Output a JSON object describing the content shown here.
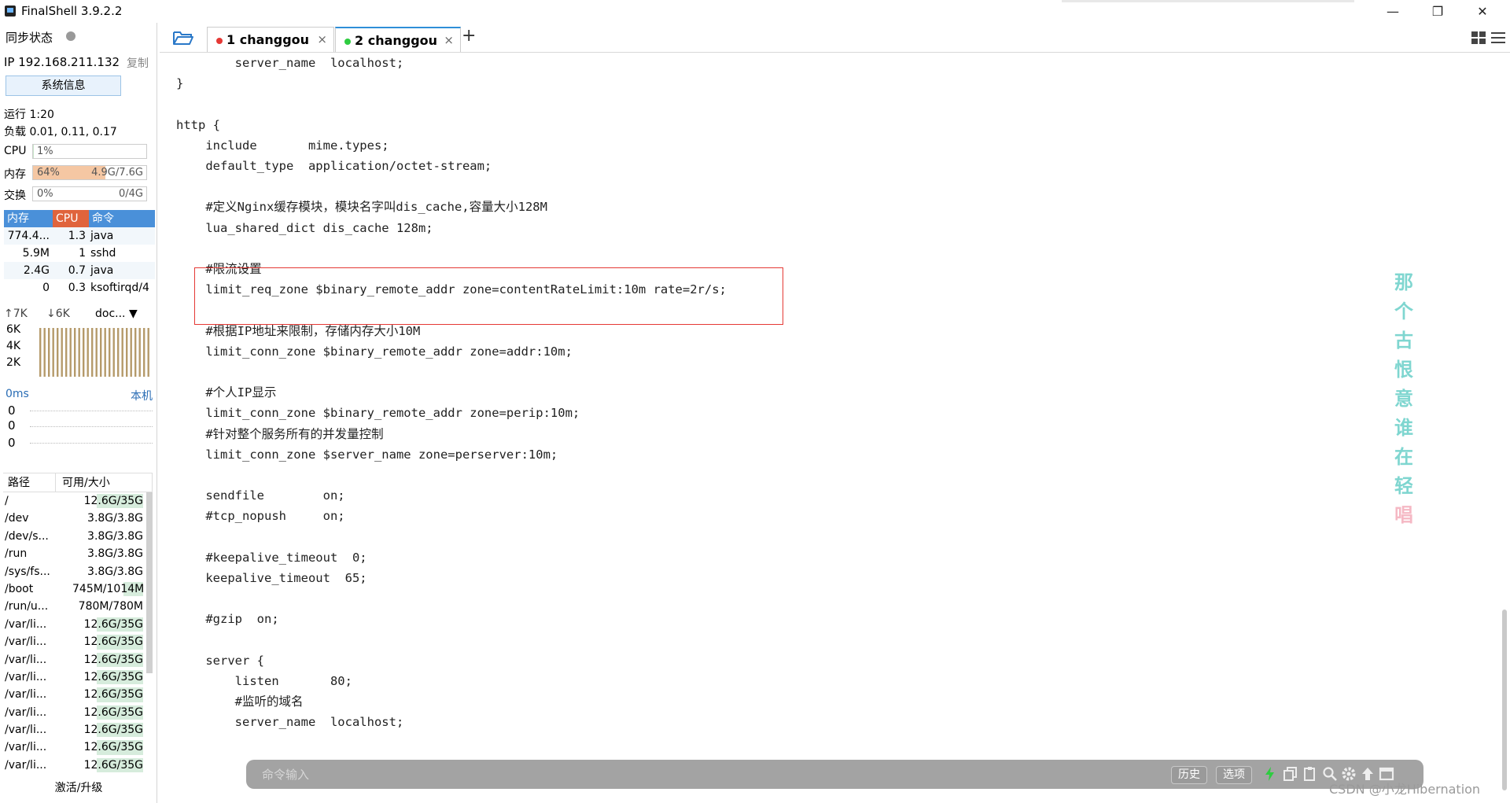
{
  "window": {
    "title": "FinalShell 3.9.2.2",
    "minimize": "—",
    "maximize": "❐",
    "close": "✕"
  },
  "left": {
    "sync_label": "同步状态",
    "ip": "IP 192.168.211.132",
    "copy": "复制",
    "sysinfo": "系统信息",
    "uptime": "运行 1:20",
    "load": "负载 0.01, 0.11, 0.17",
    "cpu": {
      "label": "CPU",
      "pct": "1%",
      "fraction": 0.01
    },
    "mem": {
      "label": "内存",
      "pct": "64%",
      "value": "4.9G/7.6G",
      "fraction": 0.64
    },
    "swap": {
      "label": "交换",
      "pct": "0%",
      "value": "0/4G",
      "fraction": 0.0
    },
    "proc_headers": [
      "内存",
      "CPU",
      "命令"
    ],
    "processes": [
      {
        "mem": "774.4...",
        "cpu": "1.3",
        "cmd": "java"
      },
      {
        "mem": "5.9M",
        "cpu": "1",
        "cmd": "sshd"
      },
      {
        "mem": "2.4G",
        "cpu": "0.7",
        "cmd": "java"
      },
      {
        "mem": "0",
        "cpu": "0.3",
        "cmd": "ksoftirqd/4"
      }
    ],
    "net": {
      "up": "↑7K",
      "down": "↓6K",
      "iface": "doc...",
      "ylabels": [
        "6K",
        "4K",
        "2K"
      ]
    },
    "latency": {
      "label": "0ms",
      "host": "本机",
      "values": [
        "0",
        "0",
        "0"
      ]
    },
    "disk_headers": [
      "路径",
      "可用/大小"
    ],
    "disks": [
      {
        "path": "/",
        "size": "12.6G/35G",
        "used": 0.64
      },
      {
        "path": "/dev",
        "size": "3.8G/3.8G",
        "used": 0.0
      },
      {
        "path": "/dev/s...",
        "size": "3.8G/3.8G",
        "used": 0.0
      },
      {
        "path": "/run",
        "size": "3.8G/3.8G",
        "used": 0.0
      },
      {
        "path": "/sys/fs...",
        "size": "3.8G/3.8G",
        "used": 0.0
      },
      {
        "path": "/boot",
        "size": "745M/1014M",
        "used": 0.27
      },
      {
        "path": "/run/u...",
        "size": "780M/780M",
        "used": 0.0
      },
      {
        "path": "/var/li...",
        "size": "12.6G/35G",
        "used": 0.64
      },
      {
        "path": "/var/li...",
        "size": "12.6G/35G",
        "used": 0.64
      },
      {
        "path": "/var/li...",
        "size": "12.6G/35G",
        "used": 0.64
      },
      {
        "path": "/var/li...",
        "size": "12.6G/35G",
        "used": 0.64
      },
      {
        "path": "/var/li...",
        "size": "12.6G/35G",
        "used": 0.64
      },
      {
        "path": "/var/li...",
        "size": "12.6G/35G",
        "used": 0.64
      },
      {
        "path": "/var/li...",
        "size": "12.6G/35G",
        "used": 0.64
      },
      {
        "path": "/var/li...",
        "size": "12.6G/35G",
        "used": 0.64
      },
      {
        "path": "/var/li...",
        "size": "12.6G/35G",
        "used": 0.64
      }
    ],
    "upgrade": "激活/升级"
  },
  "tabs": [
    {
      "label": "1 changgou",
      "status_color": "#e53935"
    },
    {
      "label": "2 changgou",
      "status_color": "#2ecc40"
    }
  ],
  "tab_close": "×",
  "tab_add": "+",
  "terminal": {
    "lines": [
      "        server_name  localhost;",
      "}",
      "",
      "http {",
      "    include       mime.types;",
      "    default_type  application/octet-stream;",
      "",
      "    #定义Nginx缓存模块，模块名字叫dis_cache,容量大小128M",
      "    lua_shared_dict dis_cache 128m;",
      "",
      "    #限流设置",
      "    limit_req_zone $binary_remote_addr zone=contentRateLimit:10m rate=2r/s;",
      "",
      "    #根据IP地址来限制，存储内存大小10M",
      "    limit_conn_zone $binary_remote_addr zone=addr:10m;",
      "",
      "    #个人IP显示",
      "    limit_conn_zone $binary_remote_addr zone=perip:10m;",
      "    #针对整个服务所有的并发量控制",
      "    limit_conn_zone $server_name zone=perserver:10m;",
      "",
      "    sendfile        on;",
      "    #tcp_nopush     on;",
      "",
      "    #keepalive_timeout  0;",
      "    keepalive_timeout  65;",
      "",
      "    #gzip  on;",
      "",
      "    server {",
      "        listen       80;",
      "        #监听的域名",
      "        server_name  localhost;"
    ]
  },
  "watermark": [
    "那",
    "个",
    "古",
    "恨",
    "意",
    "谁",
    "在",
    "轻",
    "唱"
  ],
  "cmdbar": {
    "placeholder": "命令输入",
    "history": "历史",
    "options": "选项"
  },
  "csdn": "CSDN @小龙Hibernation",
  "colors": {
    "proc_header_mem": "#4a90d9",
    "proc_header_cpu": "#e0643c",
    "proc_header_cmd": "#4a90d9",
    "mem_meter": "#f5c7a3",
    "highlight_box": "#e53935",
    "accent": "#2f8fd8"
  }
}
